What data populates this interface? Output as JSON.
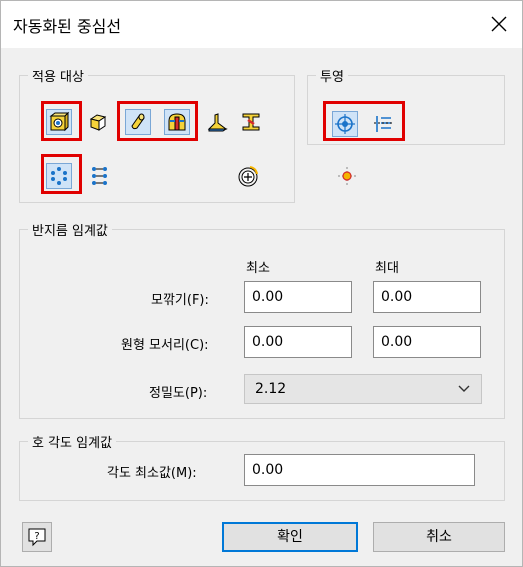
{
  "window": {
    "title": "자동화된 중심선",
    "close_glyph": "✕"
  },
  "apply_to": {
    "label": "적용 대상",
    "icons": [
      "hole-feature-icon",
      "box-feature-icon",
      "cylinder-feature-icon",
      "revolve-feature-icon",
      "sweep-feature-icon",
      "i-beam-feature-icon",
      "circular-pattern-icon",
      "rectangular-pattern-icon",
      "center-point-icon"
    ]
  },
  "projection": {
    "label": "투영",
    "icons": [
      "axis-normal-icon",
      "axis-parallel-icon",
      "sketch-point-icon"
    ]
  },
  "radius_threshold": {
    "label": "반지름 임계값",
    "min_header": "최소",
    "max_header": "최대",
    "fillet_label": "모깎기(F):",
    "fillet_min": "0.00",
    "fillet_max": "0.00",
    "corner_label": "원형 모서리(C):",
    "corner_min": "0.00",
    "corner_max": "0.00",
    "precision_label": "정밀도(P):",
    "precision_value": "2.12"
  },
  "arc_angle_threshold": {
    "label": "호 각도 임계값",
    "min_angle_label": "각도 최소값(M):",
    "min_angle_value": "0.00"
  },
  "buttons": {
    "ok": "확인",
    "cancel": "취소"
  },
  "colors": {
    "highlight_red": "#e00000",
    "accent_blue": "#0078d7"
  }
}
